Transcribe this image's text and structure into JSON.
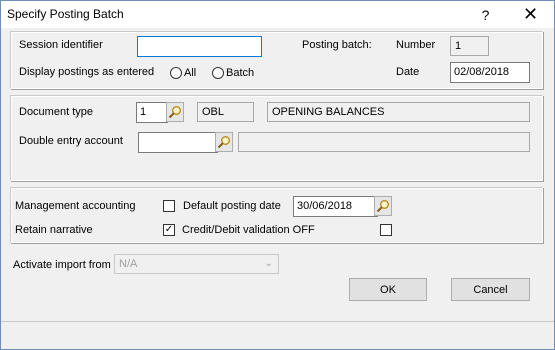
{
  "window": {
    "title": "Specify Posting Batch",
    "help_label": "?",
    "close_label": "✕"
  },
  "session": {
    "identifier_label": "Session identifier",
    "identifier_value": "",
    "posting_batch_label": "Posting batch:",
    "number_label": "Number",
    "number_value": "1",
    "display_label": "Display postings as entered",
    "radio_all": "All",
    "radio_batch": "Batch",
    "date_label": "Date",
    "date_value": "02/08/2018"
  },
  "document": {
    "type_label": "Document type",
    "type_value": "1",
    "type_code": "OBL",
    "type_description": "OPENING BALANCES",
    "double_entry_label": "Double entry account",
    "double_entry_value": "",
    "double_entry_description": ""
  },
  "options": {
    "management_label": "Management accounting",
    "management_checked": false,
    "default_posting_label": "Default posting date",
    "default_posting_value": "30/06/2018",
    "retain_label": "Retain narrative",
    "retain_checked": true,
    "credit_debit_label": "Credit/Debit validation OFF",
    "credit_debit_checked": false
  },
  "import": {
    "label": "Activate import from",
    "value": "N/A"
  },
  "buttons": {
    "ok": "OK",
    "cancel": "Cancel"
  },
  "icons": {
    "lookup": "magnifier-icon",
    "check": "✓",
    "dropdown": "chevron-down-icon"
  }
}
